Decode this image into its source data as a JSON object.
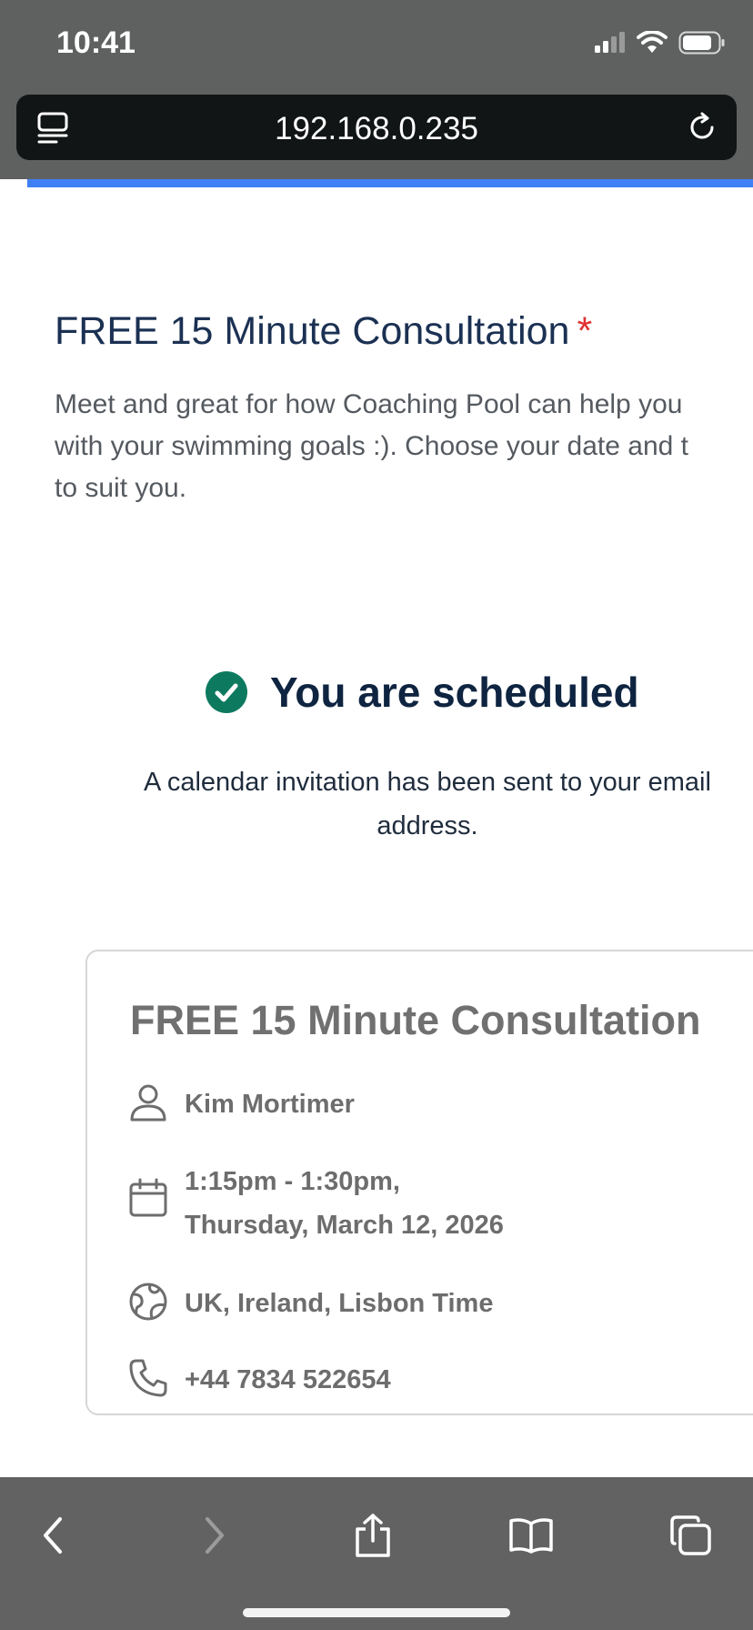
{
  "status_bar": {
    "time": "10:41"
  },
  "browser": {
    "url": "192.168.0.235"
  },
  "question": {
    "title": "FREE 15 Minute Consultation",
    "required_mark": "*",
    "description": "Meet and great for how Coaching Pool can help you\nwith your swimming goals :). Choose your date and t\nto suit you."
  },
  "confirmation": {
    "heading": "You are scheduled",
    "subtext": "A calendar invitation has been sent to your email address."
  },
  "event_card": {
    "title": "FREE 15 Minute Consultation",
    "host": "Kim Mortimer",
    "time_range": "1:15pm - 1:30pm,",
    "date": "Thursday, March 12, 2026",
    "timezone": "UK, Ireland, Lisbon Time",
    "phone": "+44 7834 522654"
  },
  "colors": {
    "accent": "#3f80f5",
    "success": "#0d7a5f",
    "required": "#e03131",
    "title": "#1b3153"
  }
}
